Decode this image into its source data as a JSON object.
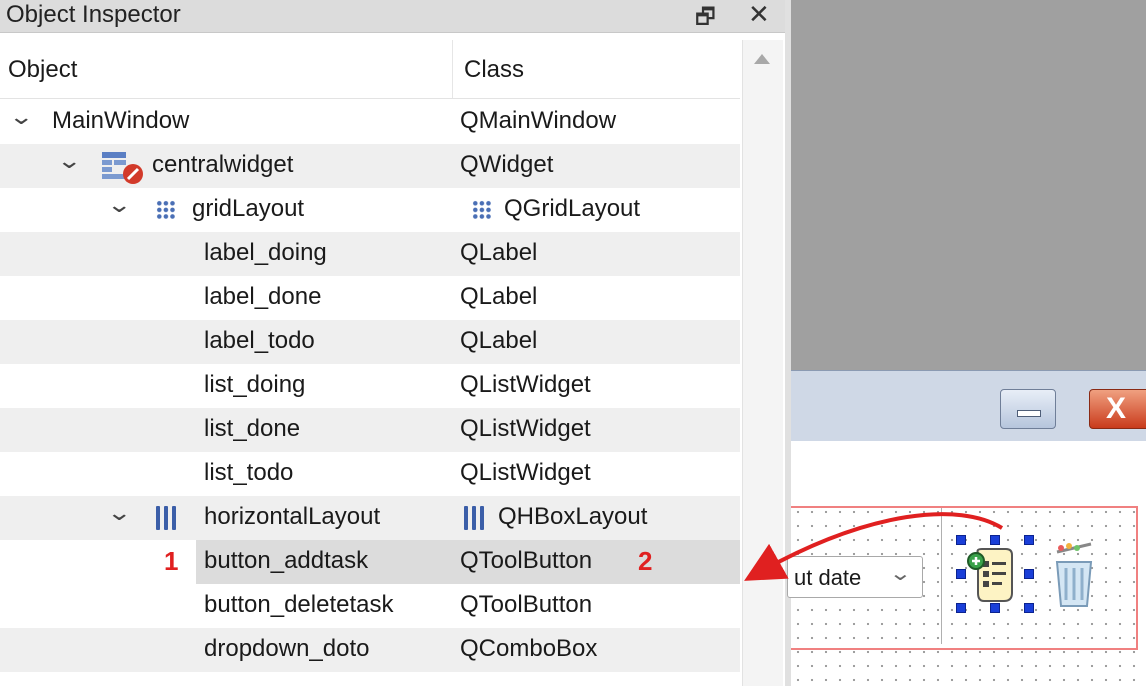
{
  "panel": {
    "title": "Object Inspector",
    "float_glyph": "🗗",
    "close_glyph": "✕"
  },
  "columns": {
    "object": "Object",
    "class": "Class"
  },
  "tree": [
    {
      "name": "MainWindow",
      "class": "QMainWindow",
      "depth": 0,
      "expanded": true
    },
    {
      "name": "centralwidget",
      "class": "QWidget",
      "depth": 1,
      "expanded": true,
      "icon": "central-widget-icon"
    },
    {
      "name": "gridLayout",
      "class": "QGridLayout",
      "depth": 2,
      "expanded": true,
      "icon": "grid-layout-icon"
    },
    {
      "name": "label_doing",
      "class": "QLabel",
      "depth": 3
    },
    {
      "name": "label_done",
      "class": "QLabel",
      "depth": 3
    },
    {
      "name": "label_todo",
      "class": "QLabel",
      "depth": 3
    },
    {
      "name": "list_doing",
      "class": "QListWidget",
      "depth": 3
    },
    {
      "name": "list_done",
      "class": "QListWidget",
      "depth": 3
    },
    {
      "name": "list_todo",
      "class": "QListWidget",
      "depth": 3
    },
    {
      "name": "horizontalLayout",
      "class": "QHBoxLayout",
      "depth": 2,
      "expanded": true,
      "icon": "hbox-layout-icon"
    },
    {
      "name": "button_addtask",
      "class": "QToolButton",
      "depth": 3,
      "selected": true
    },
    {
      "name": "button_deletetask",
      "class": "QToolButton",
      "depth": 3
    },
    {
      "name": "dropdown_doto",
      "class": "QComboBox",
      "depth": 3
    }
  ],
  "annotations": {
    "marker_1": "1",
    "marker_2": "2",
    "color": "#e02020"
  },
  "designer": {
    "combo_text": "ut date",
    "close_glyph": "X"
  },
  "colors": {
    "title_bar": "#dcdcdc",
    "alt_row": "#efefef",
    "selected_row": "#dcdcdc",
    "layout_icon": "#3b5ea8",
    "layout_border": "#f08080",
    "selection_handles": "#1a3fd8"
  }
}
